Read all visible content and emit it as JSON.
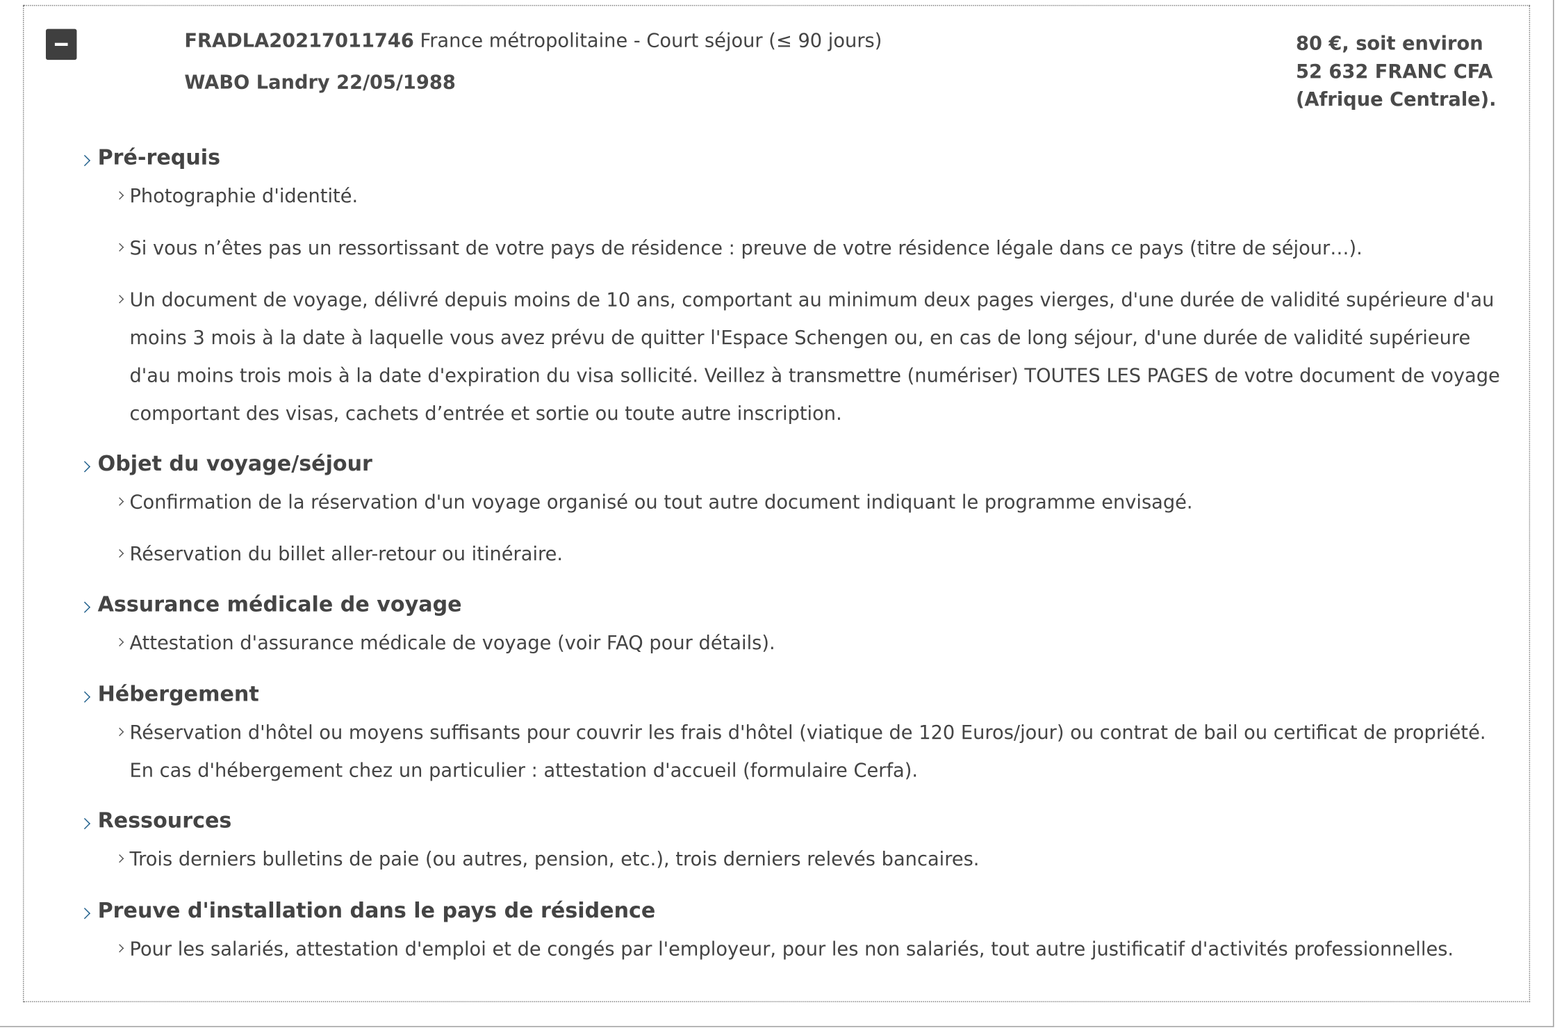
{
  "header": {
    "reference": "FRADLA20217011746",
    "visa_type": "France métropolitaine - Court séjour (≤ 90 jours)",
    "applicant": "WABO Landry 22/05/1988",
    "price_line1": "80 €, soit environ",
    "price_line2": "52 632 FRANC CFA",
    "price_line3": "(Afrique Centrale)."
  },
  "sections": [
    {
      "title": "Pré-requis",
      "items": [
        "Photographie d'identité.",
        "Si vous n’êtes pas un ressortissant de votre pays de résidence : preuve de votre résidence légale dans ce pays (titre de séjour…).",
        "Un document de voyage, délivré depuis moins de 10 ans, comportant au minimum deux pages vierges, d'une durée de validité supérieure d'au moins 3 mois à la date à laquelle vous avez prévu de quitter l'Espace Schengen ou, en cas de long séjour, d'une durée de validité supérieure d'au moins trois mois à la date d'expiration du visa sollicité. Veillez à transmettre (numériser) TOUTES LES PAGES de votre document de voyage comportant des visas, cachets d’entrée et sortie ou toute autre inscription."
      ]
    },
    {
      "title": "Objet du voyage/séjour",
      "items": [
        "Confirmation de la réservation d'un voyage organisé ou tout autre document indiquant le programme envisagé.",
        "Réservation du billet aller-retour ou itinéraire."
      ]
    },
    {
      "title": "Assurance médicale de voyage",
      "items": [
        "Attestation d'assurance médicale de voyage (voir FAQ pour détails)."
      ]
    },
    {
      "title": "Hébergement",
      "items": [
        "Réservation d'hôtel ou moyens suffisants pour couvrir les frais d'hôtel (viatique de 120 Euros/jour) ou contrat de bail ou certificat de propriété. En cas d'hébergement chez un particulier : attestation d'accueil (formulaire Cerfa)."
      ]
    },
    {
      "title": "Ressources",
      "items": [
        "Trois derniers bulletins de paie (ou autres, pension, etc.), trois derniers relevés bancaires."
      ]
    },
    {
      "title": "Preuve d'installation dans le pays de résidence",
      "items": [
        "Pour les salariés, attestation d'emploi et de congés par l'employeur, pour les non salariés, tout autre justificatif d'activités professionnelles."
      ]
    }
  ],
  "icons": {
    "collapse": "minus-icon",
    "section": "chevron-right-icon",
    "item": "chevron-right-icon"
  },
  "colors": {
    "section_chevron": "#1f5f8b",
    "collapse_button": "#3f3f3f",
    "text": "#444444"
  }
}
